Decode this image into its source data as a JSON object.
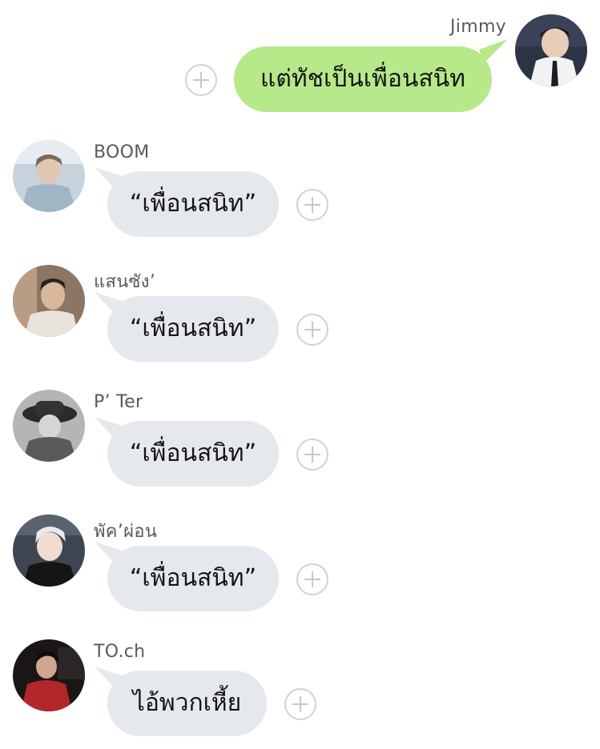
{
  "messages": [
    {
      "sender": "Jimmy",
      "text": "แต่ทัชเป็นเพื่อนสนิท",
      "outgoing": true
    },
    {
      "sender": "BOOM",
      "text": "“เพื่อนสนิท”",
      "outgoing": false
    },
    {
      "sender": "แสนซัง’",
      "text": "“เพื่อนสนิท”",
      "outgoing": false
    },
    {
      "sender": "P’ Ter",
      "text": "“เพื่อนสนิท”",
      "outgoing": false
    },
    {
      "sender": "พัค’ผ่อน",
      "text": "“เพื่อนสนิท”",
      "outgoing": false
    },
    {
      "sender": "TO.ch",
      "text": "ไอ้พวกเหี้ย",
      "outgoing": false
    }
  ],
  "icons": {
    "react_button": "plus-circle-icon"
  },
  "colors": {
    "outgoing_bubble": "#b7e889",
    "incoming_bubble": "#e5e8ec",
    "name_text": "#555a60",
    "plus_icon": "#c4c8cc"
  }
}
